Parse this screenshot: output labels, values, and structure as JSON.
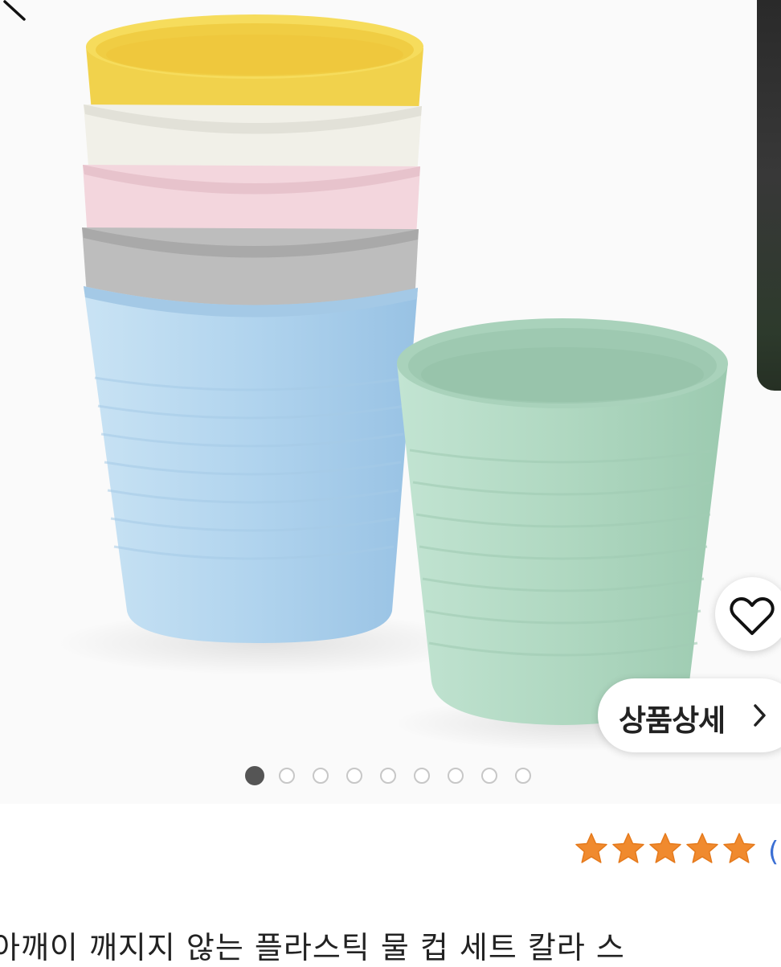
{
  "gallery": {
    "current_index": 1,
    "total_images": 9,
    "product_image": "stacked pastel plastic cups (yellow, white, pink, grey, blue) with a separate mint green cup"
  },
  "actions": {
    "back_icon": "back-arrow-icon",
    "favorite_icon": "heart-outline-icon",
    "detail_label": "상품상세",
    "detail_icon": "chevron-right-icon"
  },
  "rating": {
    "stars": 5,
    "max": 5,
    "star_color": "#f08a2e",
    "count_text": "("
  },
  "product": {
    "title": "아깨이 깨지지 않는 플라스틱 물 컵 세트 칼라 스"
  },
  "colors": {
    "cup_yellow": "#f3d656",
    "cup_white": "#f2f1ea",
    "cup_pink": "#f3d8de",
    "cup_grey": "#bcbcbc",
    "cup_blue": "#b5d7ee",
    "cup_mint": "#b6dcc6",
    "link_blue": "#3b6fd4"
  }
}
